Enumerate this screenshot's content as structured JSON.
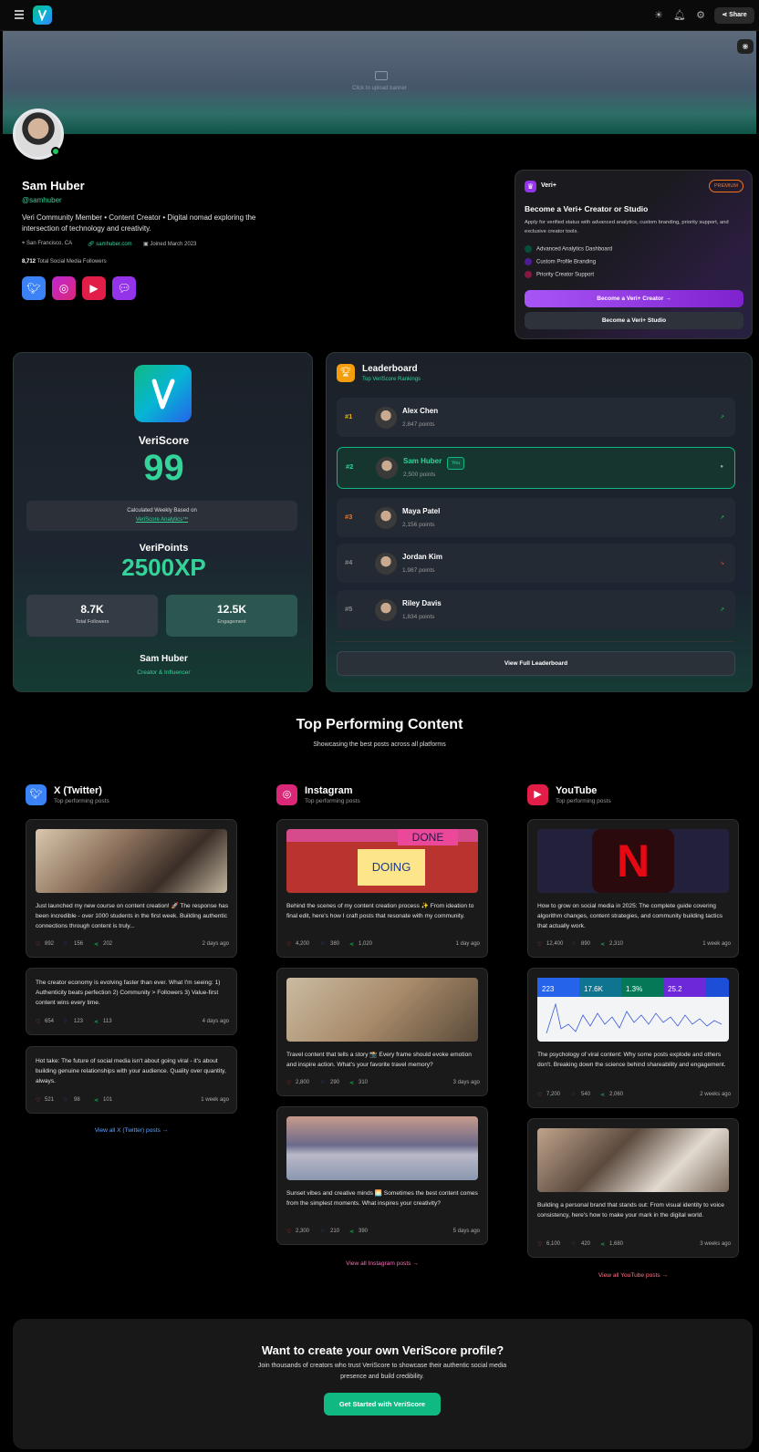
{
  "header": {
    "share_label": "Share"
  },
  "banner": {
    "upload_hint": "Click to upload banner"
  },
  "profile": {
    "name": "Sam Huber",
    "handle": "@samhuber",
    "bio": "Veri Community Member • Content Creator • Digital nomad exploring the intersection of technology and creativity.",
    "location": "San Francisco, CA",
    "website": "samhuber.com",
    "joined": "Joined March 2023",
    "followers_count": "8,712",
    "followers_label": "Total Social Media Followers"
  },
  "promo": {
    "brand": "Veri+",
    "badge": "PREMIUM",
    "title": "Become a Veri+ Creator or Studio",
    "desc": "Apply for verified status with advanced analytics, custom branding, priority support, and exclusive creator tools.",
    "features": [
      "Advanced Analytics Dashboard",
      "Custom Profile Branding",
      "Priority Creator Support"
    ],
    "primary_btn": "Become a Veri+ Creator  →",
    "secondary_btn": "Become a Veri+ Studio"
  },
  "veriscore": {
    "title": "VeriScore",
    "score": "99",
    "calc_line1": "Calculated Weekly Based on",
    "calc_link": "VeriScore Analytics™",
    "points_title": "VeriPoints",
    "points": "2500XP",
    "stat1_value": "8.7K",
    "stat1_label": "Total Followers",
    "stat2_value": "12.5K",
    "stat2_label": "Engagement",
    "name": "Sam Huber",
    "role": "Creator & Influencer"
  },
  "leaderboard": {
    "title": "Leaderboard",
    "subtitle": "Top VeriScore Rankings",
    "you_badge": "You",
    "rows": [
      {
        "rank": "#1",
        "name": "Alex Chen",
        "points": "2,847 points",
        "color": "#eab308",
        "trend": "up"
      },
      {
        "rank": "#2",
        "name": "Sam Huber",
        "points": "2,500 points",
        "color": "#34d399",
        "trend": "dot"
      },
      {
        "rank": "#3",
        "name": "Maya Patel",
        "points": "2,156 points",
        "color": "#f97316",
        "trend": "up"
      },
      {
        "rank": "#4",
        "name": "Jordan Kim",
        "points": "1,987 points",
        "color": "#888888",
        "trend": "down"
      },
      {
        "rank": "#5",
        "name": "Riley Davis",
        "points": "1,834 points",
        "color": "#888888",
        "trend": "up"
      }
    ],
    "view_full": "View Full Leaderboard"
  },
  "content": {
    "title": "Top Performing Content",
    "subtitle": "Showcasing the best posts across all platforms",
    "columns": [
      {
        "platform": "X (Twitter)",
        "sub": "Top performing posts",
        "icon": "twitter-icon",
        "color": "#3b82f6",
        "view_all": "View all X (Twitter) posts →",
        "posts": [
          {
            "text": "Just launched my new course on content creation! 🚀 The response has been incredible - over 1000 students in the first week. Building authentic connections through content is truly...",
            "likes": "892",
            "comments": "156",
            "shares": "202",
            "time": "2 days ago",
            "has_image": true
          },
          {
            "text": "The creator economy is evolving faster than ever. What I'm seeing: 1) Authenticity beats perfection 2) Community > Followers 3) Value-first content wins every time.",
            "likes": "654",
            "comments": "123",
            "shares": "113",
            "time": "4 days ago",
            "has_image": false
          },
          {
            "text": "Hot take: The future of social media isn't about going viral - it's about building genuine relationships with your audience. Quality over quantity, always.",
            "likes": "521",
            "comments": "98",
            "shares": "101",
            "time": "1 week ago",
            "has_image": false
          }
        ]
      },
      {
        "platform": "Instagram",
        "sub": "Top performing posts",
        "icon": "instagram-icon",
        "color": "#db2777",
        "view_all": "View all Instagram posts →",
        "posts": [
          {
            "text": "Behind the scenes of my content creation process ✨ From ideation to final edit, here's how I craft posts that resonate with my community.",
            "likes": "4,200",
            "comments": "380",
            "shares": "1,020",
            "time": "1 day ago",
            "has_image": true,
            "img_words": [
              "DONE",
              "DOING"
            ]
          },
          {
            "text": "Travel content that tells a story 📸 Every frame should evoke emotion and inspire action. What's your favorite travel memory?",
            "likes": "2,800",
            "comments": "290",
            "shares": "310",
            "time": "3 days ago",
            "has_image": true
          },
          {
            "text": "Sunset vibes and creative minds 🌅 Sometimes the best content comes from the simplest moments. What inspires your creativity?",
            "likes": "2,300",
            "comments": "210",
            "shares": "390",
            "time": "5 days ago",
            "has_image": true
          }
        ]
      },
      {
        "platform": "YouTube",
        "sub": "Top performing posts",
        "icon": "youtube-icon",
        "color": "#e11d48",
        "view_all": "View all YouTube posts →",
        "posts": [
          {
            "text": "How to grow on social media in 2025: The complete guide covering algorithm changes, content strategies, and community building tactics that actually work.",
            "likes": "12,400",
            "comments": "890",
            "shares": "2,310",
            "time": "1 week ago",
            "has_image": true,
            "img_letter": "N"
          },
          {
            "text": "The psychology of viral content: Why some posts explode and others don't. Breaking down the science behind shareability and engagement.",
            "likes": "7,200",
            "comments": "540",
            "shares": "2,060",
            "time": "2 weeks ago",
            "has_image": true,
            "img_metrics": [
              "223",
              "17.6K",
              "1.3%",
              "25.2"
            ]
          },
          {
            "text": "Building a personal brand that stands out: From visual identity to voice consistency, here's how to make your mark in the digital world.",
            "likes": "6,100",
            "comments": "420",
            "shares": "1,680",
            "time": "3 weeks ago",
            "has_image": true
          }
        ]
      }
    ]
  },
  "cta": {
    "title": "Want to create your own VeriScore profile?",
    "desc": "Join thousands of creators who trust VeriScore to showcase their authentic social media presence and build credibility.",
    "button": "Get Started with VeriScore"
  },
  "colors": {
    "accent": "#10b981",
    "purple": "#9333ea",
    "background": "#000000"
  }
}
